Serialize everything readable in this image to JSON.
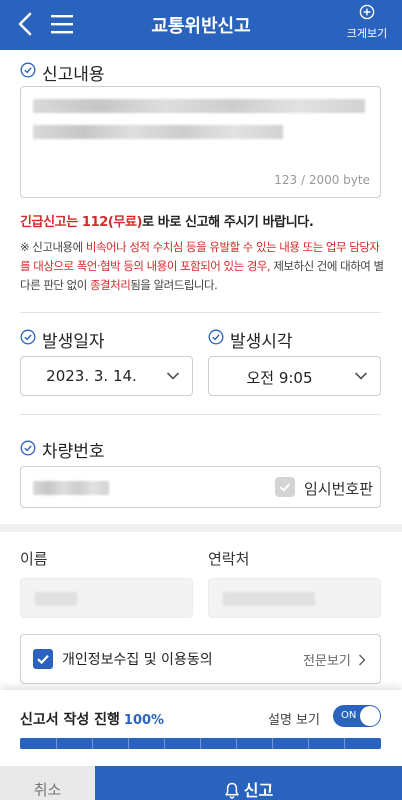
{
  "header": {
    "title": "교통위반신고",
    "zoom_label": "크게보기"
  },
  "report_content": {
    "section_title": "신고내용",
    "counter": "123 / 2000 byte"
  },
  "notice": {
    "emergency_red": "긴급신고는 112(무료)",
    "emergency_rest": "로 바로 신고해 주시기 바랍니다.",
    "warn_prefix": "※ 신고내용에 ",
    "warn_red1": "비속어나 성적 수치심 등을 유발할 수 있는 내용 또는 업무 담당자를 대상으로 폭언·협박 등의 내용이 포함되어 있는 경우,",
    "warn_mid": " 제보하신 건에 대하여 별다른 판단 없이 ",
    "warn_red2": "종결처리",
    "warn_suffix": "됨을 알려드립니다."
  },
  "occurrence": {
    "date_title": "발생일자",
    "date_value": "2023. 3. 14.",
    "time_title": "발생시각",
    "time_value": "오전 9:05"
  },
  "vehicle": {
    "title": "차량번호",
    "temp_plate_label": "임시번호판"
  },
  "contact": {
    "name_label": "이름",
    "phone_label": "연락처"
  },
  "consent": {
    "label": "개인정보수집 및 이용동의",
    "view_full": "전문보기"
  },
  "progress": {
    "title": "신고서 작성 진행",
    "percent_text": "100%",
    "percent": 100,
    "desc_label": "설명 보기",
    "toggle_label": "ON"
  },
  "footer": {
    "cancel": "취소",
    "report": "신고"
  },
  "colors": {
    "primary": "#2a63bd",
    "warning": "#d42a2a"
  }
}
